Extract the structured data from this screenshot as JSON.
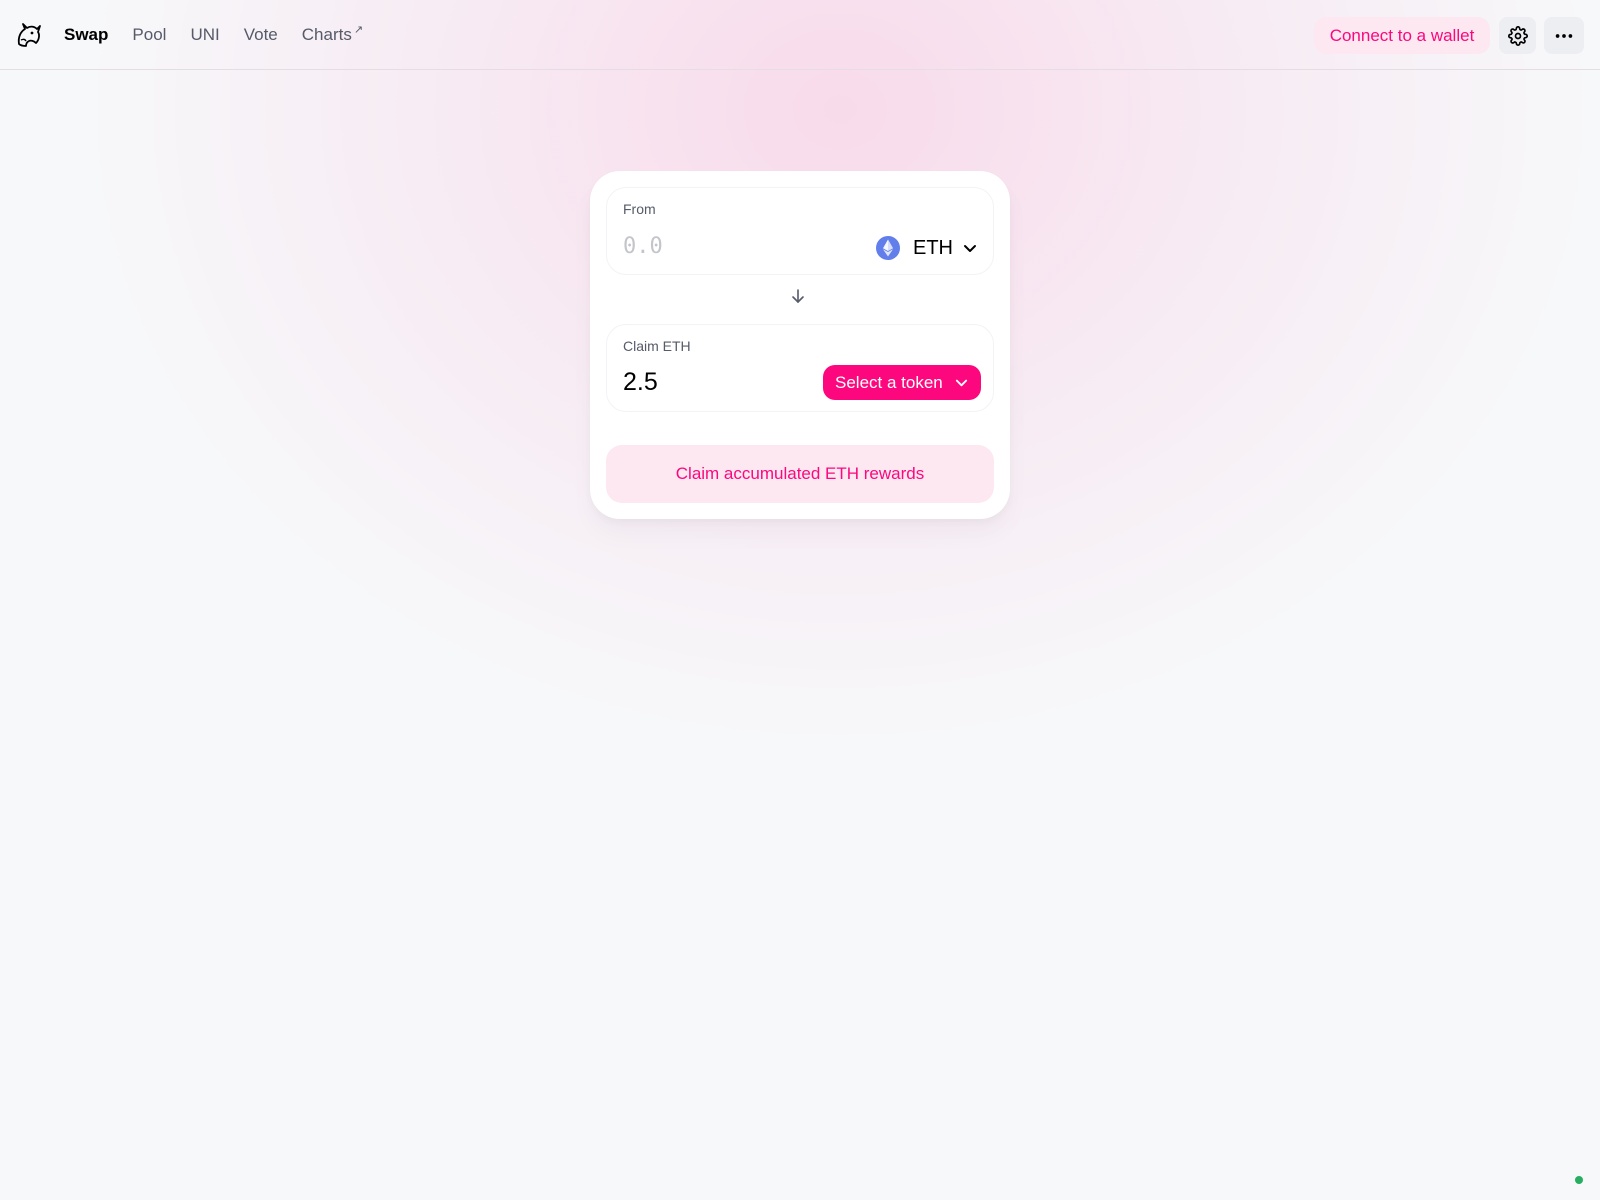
{
  "nav": {
    "items": [
      {
        "label": "Swap",
        "active": true
      },
      {
        "label": "Pool"
      },
      {
        "label": "UNI"
      },
      {
        "label": "Vote"
      },
      {
        "label": "Charts",
        "external": true
      }
    ],
    "external_arrow": "↗"
  },
  "header": {
    "connect_label": "Connect to a wallet",
    "settings_icon": "gear-icon",
    "menu_icon": "more-horizontal-icon"
  },
  "swap": {
    "from": {
      "label": "From",
      "placeholder": "0.0",
      "value": "",
      "token": "ETH"
    },
    "claim": {
      "label": "Claim ETH",
      "value": "2.5",
      "select_label": "Select a token"
    },
    "action_label": "Claim accumulated ETH rewards"
  },
  "colors": {
    "accent": "#fc077d",
    "accent_soft": "#fde7f1",
    "eth": "#627eea",
    "status": "#27ae60"
  }
}
